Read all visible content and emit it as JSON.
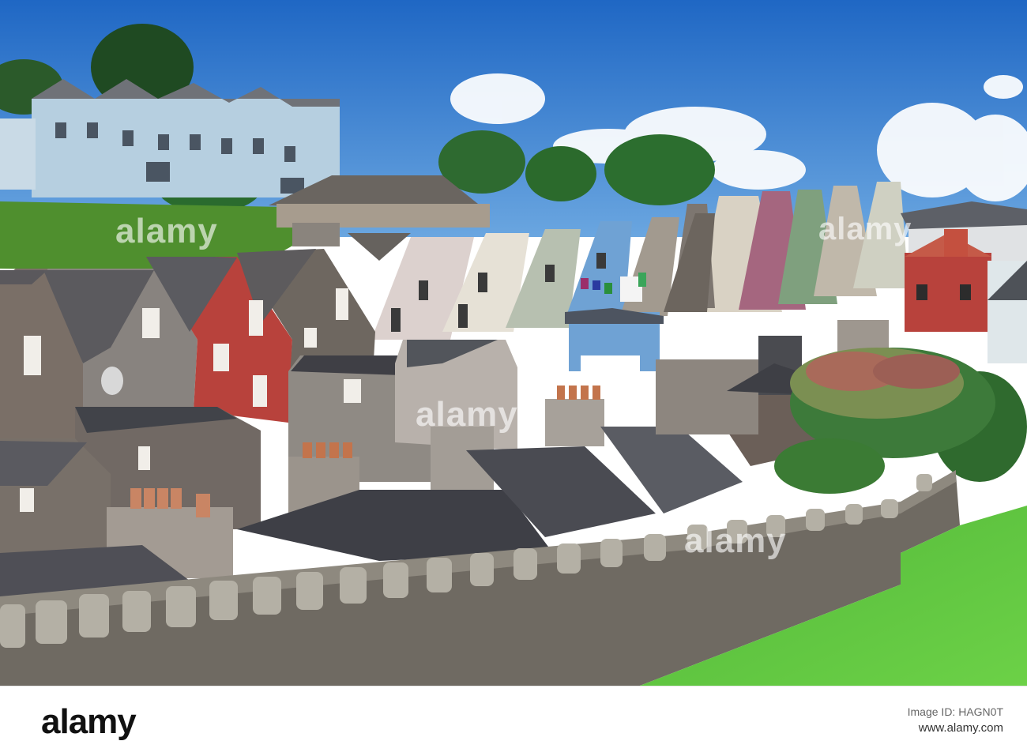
{
  "image": {
    "subject": "Row of colourful terraced houses on a hillside behind a stone wall",
    "palette": {
      "sky": "#2f7bd0",
      "grass": "#5ac13f",
      "wall": "#6f6a62",
      "red_house": "#b8423c",
      "blue_house": "#6fa2d4",
      "pink_house": "#a5667f",
      "green_house": "#7fa07e"
    }
  },
  "watermark": {
    "text": "alamy"
  },
  "footer": {
    "logo": "alamy",
    "image_id": "Image ID: HAGN0T",
    "url": "www.alamy.com"
  }
}
